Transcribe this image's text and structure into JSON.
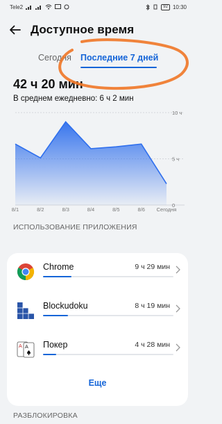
{
  "status_bar": {
    "carrier": "Tele2",
    "battery": "92",
    "time": "10:30"
  },
  "header": {
    "title": "Доступное время"
  },
  "tabs": [
    {
      "label": "Сегодня",
      "active": false
    },
    {
      "label": "Последние 7 дней",
      "active": true
    }
  ],
  "summary": {
    "total": "42 ч 20 мин",
    "average": "В среднем ежедневно: 6 ч 2 мин"
  },
  "chart_data": {
    "type": "area",
    "categories": [
      "8/1",
      "8/2",
      "8/3",
      "8/4",
      "8/5",
      "8/6",
      "Сегодня"
    ],
    "values": [
      6.6,
      5.1,
      9.0,
      6.1,
      6.3,
      6.6,
      2.3
    ],
    "y_tick_labels": [
      "10 ч",
      "5 ч",
      "0"
    ],
    "ylim": [
      0,
      10
    ],
    "grid": true,
    "color": "#2f6fed"
  },
  "apps_section": {
    "label": "ИСПОЛЬЗОВАНИЕ ПРИЛОЖЕНИЯ"
  },
  "apps": [
    {
      "name": "Chrome",
      "time": "9 ч 29 мин",
      "usage_fraction": 0.22
    },
    {
      "name": "Blockudoku",
      "time": "8 ч 19 мин",
      "usage_fraction": 0.19
    },
    {
      "name": "Покер",
      "time": "4 ч 28 мин",
      "usage_fraction": 0.1
    }
  ],
  "more_button": "Еще",
  "unlock_section": {
    "label": "РАЗБЛОКИРОВКА"
  },
  "colors": {
    "accent": "#1565d8",
    "annotation": "#f07a2a"
  }
}
